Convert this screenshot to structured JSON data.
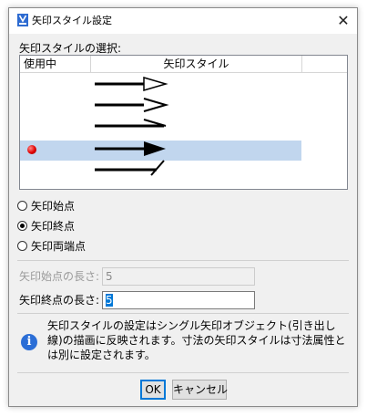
{
  "window": {
    "title": "矢印スタイル設定",
    "close_glyph": "✕"
  },
  "section_label": "矢印スタイルの選択:",
  "list": {
    "columns": [
      "使用中",
      "矢印スタイル",
      ""
    ],
    "selected_row": 3,
    "arrow_styles": [
      "open-triangle",
      "open-chevron",
      "barb",
      "filled-triangle",
      "slash"
    ],
    "in_use_marker": "red-dot",
    "selection_color": "#c1d6ee"
  },
  "radios": [
    {
      "label": "矢印始点",
      "checked": false
    },
    {
      "label": "矢印終点",
      "checked": true
    },
    {
      "label": "矢印両端点",
      "checked": false
    }
  ],
  "start_length": {
    "label": "矢印始点の長さ:",
    "value": "5",
    "enabled": false
  },
  "end_length": {
    "label": "矢印終点の長さ:",
    "value": "5",
    "enabled": true
  },
  "info": {
    "icon": "info-icon",
    "text": "矢印スタイルの設定はシングル矢印オブジェクト(引き出し線)の描画に反映されます。寸法の矢印スタイルは寸法属性とは別に設定されます。"
  },
  "buttons": {
    "ok": "OK",
    "cancel": "キャンセル"
  },
  "colors": {
    "accent": "#0078d7",
    "info": "#2b6ed6",
    "marker": "#e00000"
  }
}
